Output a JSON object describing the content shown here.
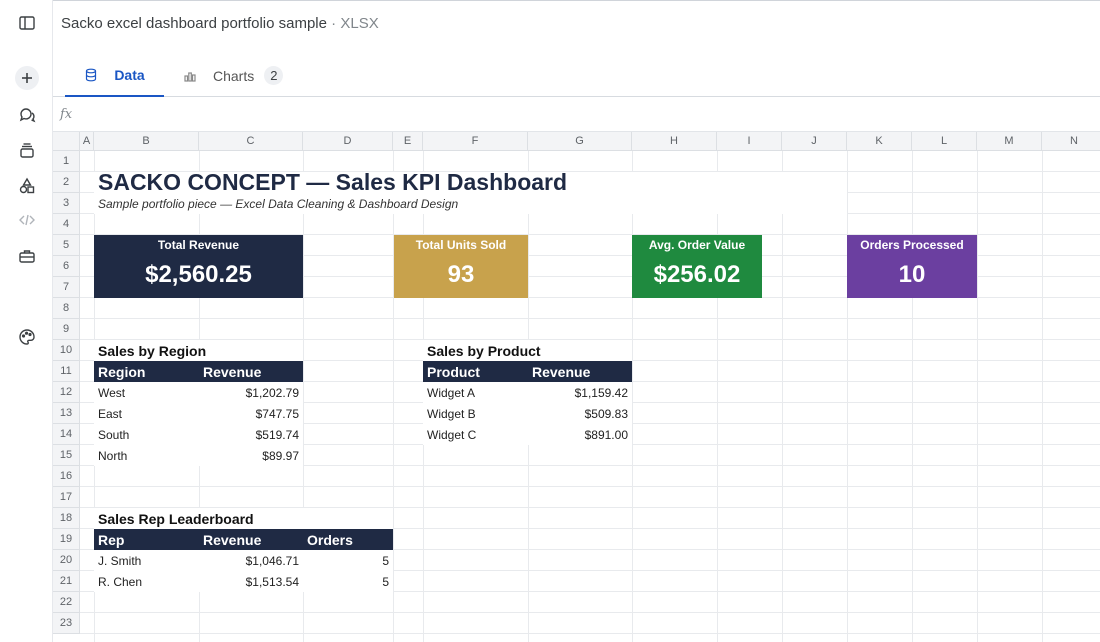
{
  "document": {
    "name": "Sacko excel dashboard portfolio sample",
    "ext": "XLSX",
    "separator": " · "
  },
  "tabs": {
    "data_label": "Data",
    "charts_label": "Charts",
    "charts_count": "2"
  },
  "formula_bar": {
    "fx_label": "fx",
    "value": ""
  },
  "icons": [
    "sidebar-toggle-icon",
    "plus-icon",
    "chat-icon",
    "layers-icon",
    "shapes-icon",
    "code-icon",
    "briefcase-icon",
    "palette-icon",
    "database-icon",
    "bar-chart-icon"
  ],
  "columns": [
    "A",
    "B",
    "C",
    "D",
    "E",
    "F",
    "G",
    "H",
    "I",
    "J",
    "K",
    "L",
    "M",
    "N"
  ],
  "rows": [
    "1",
    "2",
    "3",
    "4",
    "5",
    "6",
    "7",
    "8",
    "9",
    "10",
    "11",
    "12",
    "13",
    "14",
    "15",
    "16",
    "17",
    "18",
    "19",
    "20",
    "21",
    "22",
    "23"
  ],
  "sheet": {
    "title": "SACKO CONCEPT — Sales KPI Dashboard",
    "subtitle": "Sample portfolio piece — Excel Data Cleaning & Dashboard Design",
    "kpis": [
      {
        "label": "Total Revenue",
        "value": "$2,560.25",
        "color": "#1f2a44"
      },
      {
        "label": "Total Units Sold",
        "value": "93",
        "color": "#c8a24c"
      },
      {
        "label": "Avg. Order Value",
        "value": "$256.02",
        "color": "#1f8a3f"
      },
      {
        "label": "Orders Processed",
        "value": "10",
        "color": "#6b3fa0"
      }
    ],
    "region": {
      "title": "Sales by Region",
      "headers": [
        "Region",
        "Revenue"
      ],
      "rows": [
        [
          "West",
          "$1,202.79"
        ],
        [
          "East",
          "$747.75"
        ],
        [
          "South",
          "$519.74"
        ],
        [
          "North",
          "$89.97"
        ]
      ]
    },
    "product": {
      "title": "Sales by Product",
      "headers": [
        "Product",
        "Revenue"
      ],
      "rows": [
        [
          "Widget A",
          "$1,159.42"
        ],
        [
          "Widget B",
          "$509.83"
        ],
        [
          "Widget C",
          "$891.00"
        ]
      ]
    },
    "leaderboard": {
      "title": "Sales Rep Leaderboard",
      "headers": [
        "Rep",
        "Revenue",
        "Orders"
      ],
      "rows": [
        [
          "J. Smith",
          "$1,046.71",
          "5"
        ],
        [
          "R. Chen",
          "$1,513.54",
          "5"
        ]
      ]
    }
  },
  "theme": {
    "accent": "#1a56c4",
    "header_fill": "#1f2a44"
  }
}
